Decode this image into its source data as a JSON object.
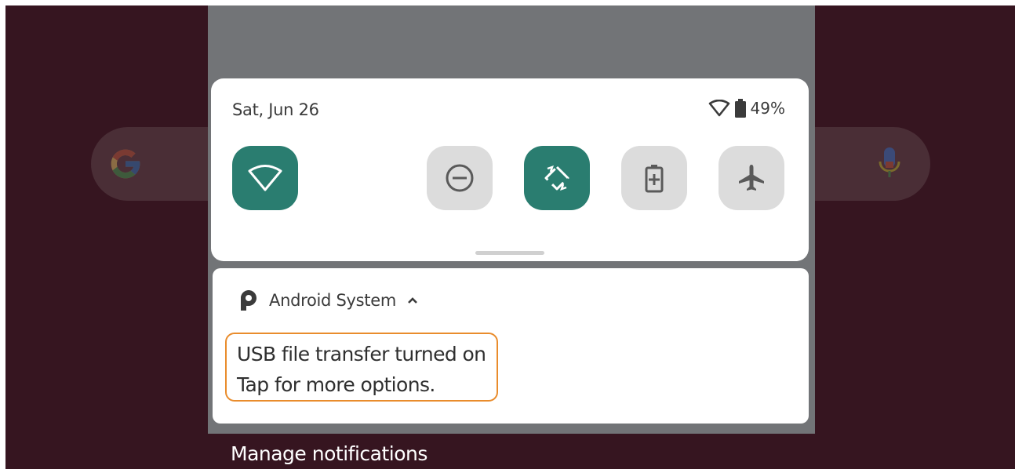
{
  "home": {
    "search_bar": {
      "logo_icon": "google-g-icon",
      "mic_icon": "mic-icon"
    }
  },
  "quick_settings": {
    "date": "Sat, Jun 26",
    "status": {
      "wifi_icon": "wifi-icon",
      "battery_icon": "battery-icon",
      "battery_level": "49%"
    },
    "tiles": [
      {
        "name": "wifi",
        "icon": "wifi-icon",
        "state": "on"
      },
      {
        "name": "do-not-disturb",
        "icon": "do-not-disturb-icon",
        "state": "off"
      },
      {
        "name": "auto-rotate",
        "icon": "auto-rotate-icon",
        "state": "on"
      },
      {
        "name": "battery-saver",
        "icon": "battery-saver-icon",
        "state": "off"
      },
      {
        "name": "airplane-mode",
        "icon": "airplane-icon",
        "state": "off"
      }
    ],
    "colors": {
      "tile_on": "#2a7d70",
      "tile_off": "#dcdcdc"
    }
  },
  "notification": {
    "app_icon": "android-system-icon",
    "app_name": "Android System",
    "expand_icon": "chevron-up-icon",
    "title": "USB file transfer turned on",
    "text": "Tap for more options.",
    "highlight_color": "#e98c2c"
  },
  "footer": {
    "manage_label": "Manage notifications"
  }
}
